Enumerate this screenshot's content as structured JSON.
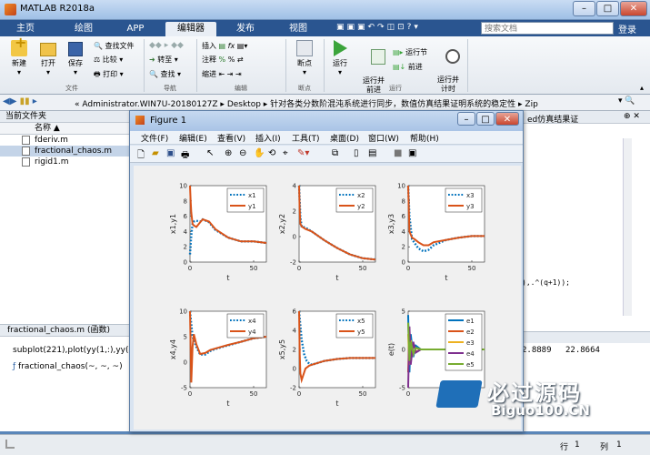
{
  "app": {
    "title": "MATLAB R2018a"
  },
  "tabs": [
    {
      "label": "主页"
    },
    {
      "label": "绘图"
    },
    {
      "label": "APP"
    },
    {
      "label": "编辑器"
    },
    {
      "label": "发布"
    },
    {
      "label": "视图"
    }
  ],
  "search": {
    "placeholder": "搜索文档"
  },
  "login": "登录",
  "ribbon": {
    "new": "新建",
    "open": "打开",
    "save": "保存",
    "find_files": "查找文件",
    "compare": "比较",
    "print": "打印",
    "file_group": "文件",
    "goto": "转至",
    "find": "查找",
    "nav_group": "导航",
    "insert": "插入",
    "comment": "注释",
    "indent": "缩进",
    "edit_group": "编辑",
    "breakpoints": "断点",
    "bp_group": "断点",
    "run": "运行",
    "run_advance": "运行并\n前进",
    "run_section": "运行节",
    "advance": "前进",
    "run_time": "运行并\n计时",
    "run_group": "运行"
  },
  "address": {
    "path": "«  Administrator.WIN7U-20180127Z  ▸  Desktop  ▸  针对各类分数阶混沌系统进行同步，数值仿真结果证明系统的稳定性  ▸  Zip"
  },
  "left": {
    "header": "当前文件夹",
    "col": "名称 ▲",
    "files": [
      {
        "name": "fderiv.m"
      },
      {
        "name": "fractional_chaos.m"
      },
      {
        "name": "rigid1.m"
      }
    ],
    "detail_title": "fractional_chaos.m  (函数)",
    "code_line": "subplot(221),plot(yy(1,:),yy(4,:)",
    "func_sig": "fractional_chaos(~, ~, ~)"
  },
  "editor": {
    "right_text": "ed仿真结果证",
    "formula": "),.^(q+1));",
    "nums": [
      "2.8889",
      "22.8664"
    ]
  },
  "status": {
    "row_label": "行",
    "row": "1",
    "col_label": "列",
    "col": "1"
  },
  "figure": {
    "title": "Figure 1",
    "menu": [
      {
        "label": "文件(F)"
      },
      {
        "label": "编辑(E)"
      },
      {
        "label": "查看(V)"
      },
      {
        "label": "插入(I)"
      },
      {
        "label": "工具(T)"
      },
      {
        "label": "桌面(D)"
      },
      {
        "label": "窗口(W)"
      },
      {
        "label": "帮助(H)"
      }
    ]
  },
  "watermark": {
    "cn": "必过源码",
    "en": "Biguo100.CN"
  },
  "chart_data": [
    {
      "type": "line",
      "ylabel": "x1,y1",
      "xlabel": "t",
      "xlim": [
        0,
        60
      ],
      "ylim": [
        0,
        10
      ],
      "yticks": [
        0,
        2,
        4,
        6,
        8,
        10
      ],
      "xticks": [
        0,
        50
      ],
      "series": [
        {
          "name": "x1",
          "style": "dotted",
          "color": "#0072bd",
          "x": [
            0,
            1,
            2,
            3,
            5,
            8,
            10,
            15,
            20,
            30,
            40,
            50,
            60
          ],
          "y": [
            1,
            3.5,
            5,
            5.3,
            5.4,
            5.3,
            5.6,
            5.2,
            4.2,
            3.2,
            2.7,
            2.7,
            2.5
          ]
        },
        {
          "name": "y1",
          "style": "solid",
          "color": "#d95319",
          "x": [
            0,
            0.5,
            1,
            2,
            3,
            5,
            8,
            10,
            15,
            20,
            30,
            40,
            50,
            60
          ],
          "y": [
            10,
            8,
            6.5,
            5,
            4.8,
            4.6,
            5.2,
            5.6,
            5.3,
            4.3,
            3.2,
            2.7,
            2.7,
            2.5
          ]
        }
      ]
    },
    {
      "type": "line",
      "ylabel": "x2,y2",
      "xlabel": "t",
      "xlim": [
        0,
        60
      ],
      "ylim": [
        -2,
        4
      ],
      "yticks": [
        -2,
        0,
        2,
        4
      ],
      "xticks": [
        0,
        50
      ],
      "series": [
        {
          "name": "x2",
          "style": "dotted",
          "color": "#0072bd",
          "x": [
            0,
            1,
            2,
            5,
            10,
            20,
            30,
            40,
            50,
            60
          ],
          "y": [
            4,
            1.5,
            0.8,
            0.7,
            0.4,
            -0.3,
            -0.9,
            -1.4,
            -1.7,
            -1.8
          ]
        },
        {
          "name": "y2",
          "style": "solid",
          "color": "#d95319",
          "x": [
            0,
            0.5,
            1,
            2,
            5,
            10,
            20,
            30,
            40,
            50,
            60
          ],
          "y": [
            4,
            2,
            1,
            0.8,
            0.6,
            0.4,
            -0.3,
            -0.9,
            -1.4,
            -1.7,
            -1.8
          ]
        }
      ]
    },
    {
      "type": "line",
      "ylabel": "x3,y3",
      "xlabel": "t",
      "xlim": [
        0,
        60
      ],
      "ylim": [
        0,
        10
      ],
      "yticks": [
        0,
        2,
        4,
        6,
        8,
        10
      ],
      "xticks": [
        0,
        50
      ],
      "series": [
        {
          "name": "x3",
          "style": "dotted",
          "color": "#0072bd",
          "x": [
            0,
            1,
            3,
            5,
            8,
            12,
            16,
            20,
            30,
            40,
            50,
            60
          ],
          "y": [
            10,
            6,
            3,
            2.5,
            1.8,
            1.4,
            1.6,
            2.2,
            2.9,
            3.2,
            3.4,
            3.4
          ]
        },
        {
          "name": "y3",
          "style": "solid",
          "color": "#d95319",
          "x": [
            0,
            0.5,
            1,
            3,
            5,
            8,
            12,
            16,
            20,
            30,
            40,
            50,
            60
          ],
          "y": [
            10,
            7,
            4,
            3.2,
            3,
            2.6,
            2.2,
            2.2,
            2.6,
            2.9,
            3.2,
            3.4,
            3.4
          ]
        }
      ]
    },
    {
      "type": "line",
      "ylabel": "x4,y4",
      "xlabel": "t",
      "xlim": [
        0,
        60
      ],
      "ylim": [
        -5,
        10
      ],
      "yticks": [
        -5,
        0,
        5,
        10
      ],
      "xticks": [
        0,
        50
      ],
      "series": [
        {
          "name": "x4",
          "style": "dotted",
          "color": "#0072bd",
          "x": [
            0,
            2,
            5,
            8,
            12,
            16,
            20,
            30,
            40,
            50,
            60
          ],
          "y": [
            10,
            5,
            3,
            1.5,
            1.5,
            2.2,
            2.6,
            3.3,
            4,
            4.7,
            5
          ]
        },
        {
          "name": "y4",
          "style": "solid",
          "color": "#d95319",
          "x": [
            0,
            1,
            2,
            3,
            5,
            8,
            12,
            16,
            20,
            30,
            40,
            50,
            60
          ],
          "y": [
            10,
            -4,
            3,
            5.5,
            3.5,
            1.6,
            1.8,
            2.4,
            2.7,
            3.4,
            4,
            4.7,
            5
          ]
        }
      ]
    },
    {
      "type": "line",
      "ylabel": "x5,y5",
      "xlabel": "t",
      "xlim": [
        0,
        60
      ],
      "ylim": [
        -2,
        6
      ],
      "yticks": [
        -2,
        0,
        2,
        4,
        6
      ],
      "xticks": [
        0,
        50
      ],
      "series": [
        {
          "name": "x5",
          "style": "dotted",
          "color": "#0072bd",
          "x": [
            0,
            2,
            4,
            6,
            8,
            10,
            15,
            20,
            30,
            40,
            50,
            60
          ],
          "y": [
            6,
            3,
            1.5,
            0.8,
            0.5,
            0.4,
            0.6,
            0.8,
            1,
            1.1,
            1.1,
            1.1
          ]
        },
        {
          "name": "y5",
          "style": "solid",
          "color": "#d95319",
          "x": [
            0,
            0.5,
            1,
            2,
            3,
            5,
            8,
            10,
            15,
            20,
            30,
            40,
            50,
            60
          ],
          "y": [
            6,
            1.5,
            -0.5,
            -1.2,
            -0.8,
            0,
            0.3,
            0.4,
            0.6,
            0.8,
            1,
            1.1,
            1.1,
            1.1
          ]
        }
      ]
    },
    {
      "type": "line",
      "ylabel": "e(t)",
      "xlabel": "t",
      "xlim": [
        0,
        60
      ],
      "ylim": [
        -5,
        5
      ],
      "yticks": [
        -5,
        0,
        5
      ],
      "xticks": [
        0,
        50
      ],
      "series": [
        {
          "name": "e1",
          "style": "solid",
          "color": "#0072bd",
          "x": [
            0,
            1,
            2,
            4,
            6,
            10,
            15,
            60
          ],
          "y": [
            4.5,
            -3,
            2,
            -1,
            0.5,
            0,
            0,
            0
          ]
        },
        {
          "name": "e2",
          "style": "solid",
          "color": "#d95319",
          "x": [
            0,
            1,
            2,
            4,
            6,
            10,
            15,
            60
          ],
          "y": [
            -3,
            2.5,
            -1.5,
            0.8,
            -0.3,
            0,
            0,
            0
          ]
        },
        {
          "name": "e3",
          "style": "solid",
          "color": "#edb120",
          "x": [
            0,
            1,
            2,
            4,
            6,
            10,
            15,
            60
          ],
          "y": [
            2,
            -2,
            1.2,
            -0.6,
            0.2,
            0,
            0,
            0
          ]
        },
        {
          "name": "e4",
          "style": "solid",
          "color": "#7e2f8e",
          "x": [
            0,
            1,
            2,
            4,
            6,
            10,
            15,
            60
          ],
          "y": [
            -5,
            3,
            -2,
            1,
            -0.4,
            0,
            0,
            0
          ]
        },
        {
          "name": "e5",
          "style": "solid",
          "color": "#77ac30",
          "x": [
            0,
            1,
            2,
            4,
            6,
            10,
            15,
            60
          ],
          "y": [
            3.5,
            -1.5,
            1,
            -0.5,
            0.2,
            0,
            0,
            0
          ]
        }
      ]
    }
  ]
}
